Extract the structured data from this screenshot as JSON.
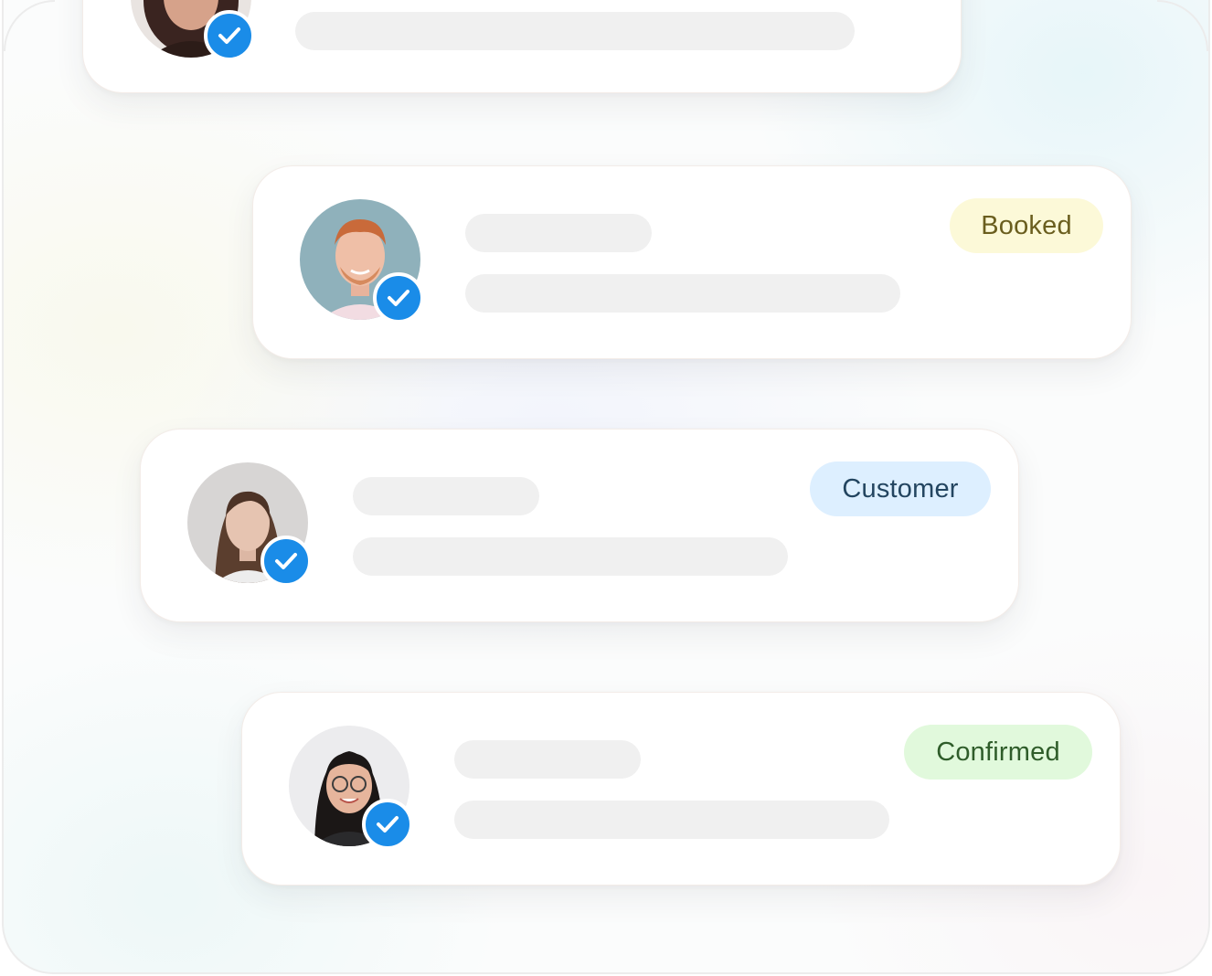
{
  "theme": {
    "check_color": "#1a8ce8",
    "skeleton_color": "#f0f0f0",
    "card_background": "#ffffff"
  },
  "cards": [
    {
      "avatar": "profile-photo-woman-curly-hair",
      "verified_icon": "checkmark-icon",
      "status": null
    },
    {
      "avatar": "profile-photo-man-red-hair",
      "verified_icon": "checkmark-icon",
      "status": {
        "label": "Booked",
        "background": "#fcf9d8",
        "color": "#6a5e1e"
      }
    },
    {
      "avatar": "profile-photo-woman-brown-hair",
      "verified_icon": "checkmark-icon",
      "status": {
        "label": "Customer",
        "background": "#ddefff",
        "color": "#234560"
      }
    },
    {
      "avatar": "profile-photo-woman-glasses",
      "verified_icon": "checkmark-icon",
      "status": {
        "label": "Confirmed",
        "background": "#e1f9dc",
        "color": "#2f5d2a"
      }
    }
  ]
}
